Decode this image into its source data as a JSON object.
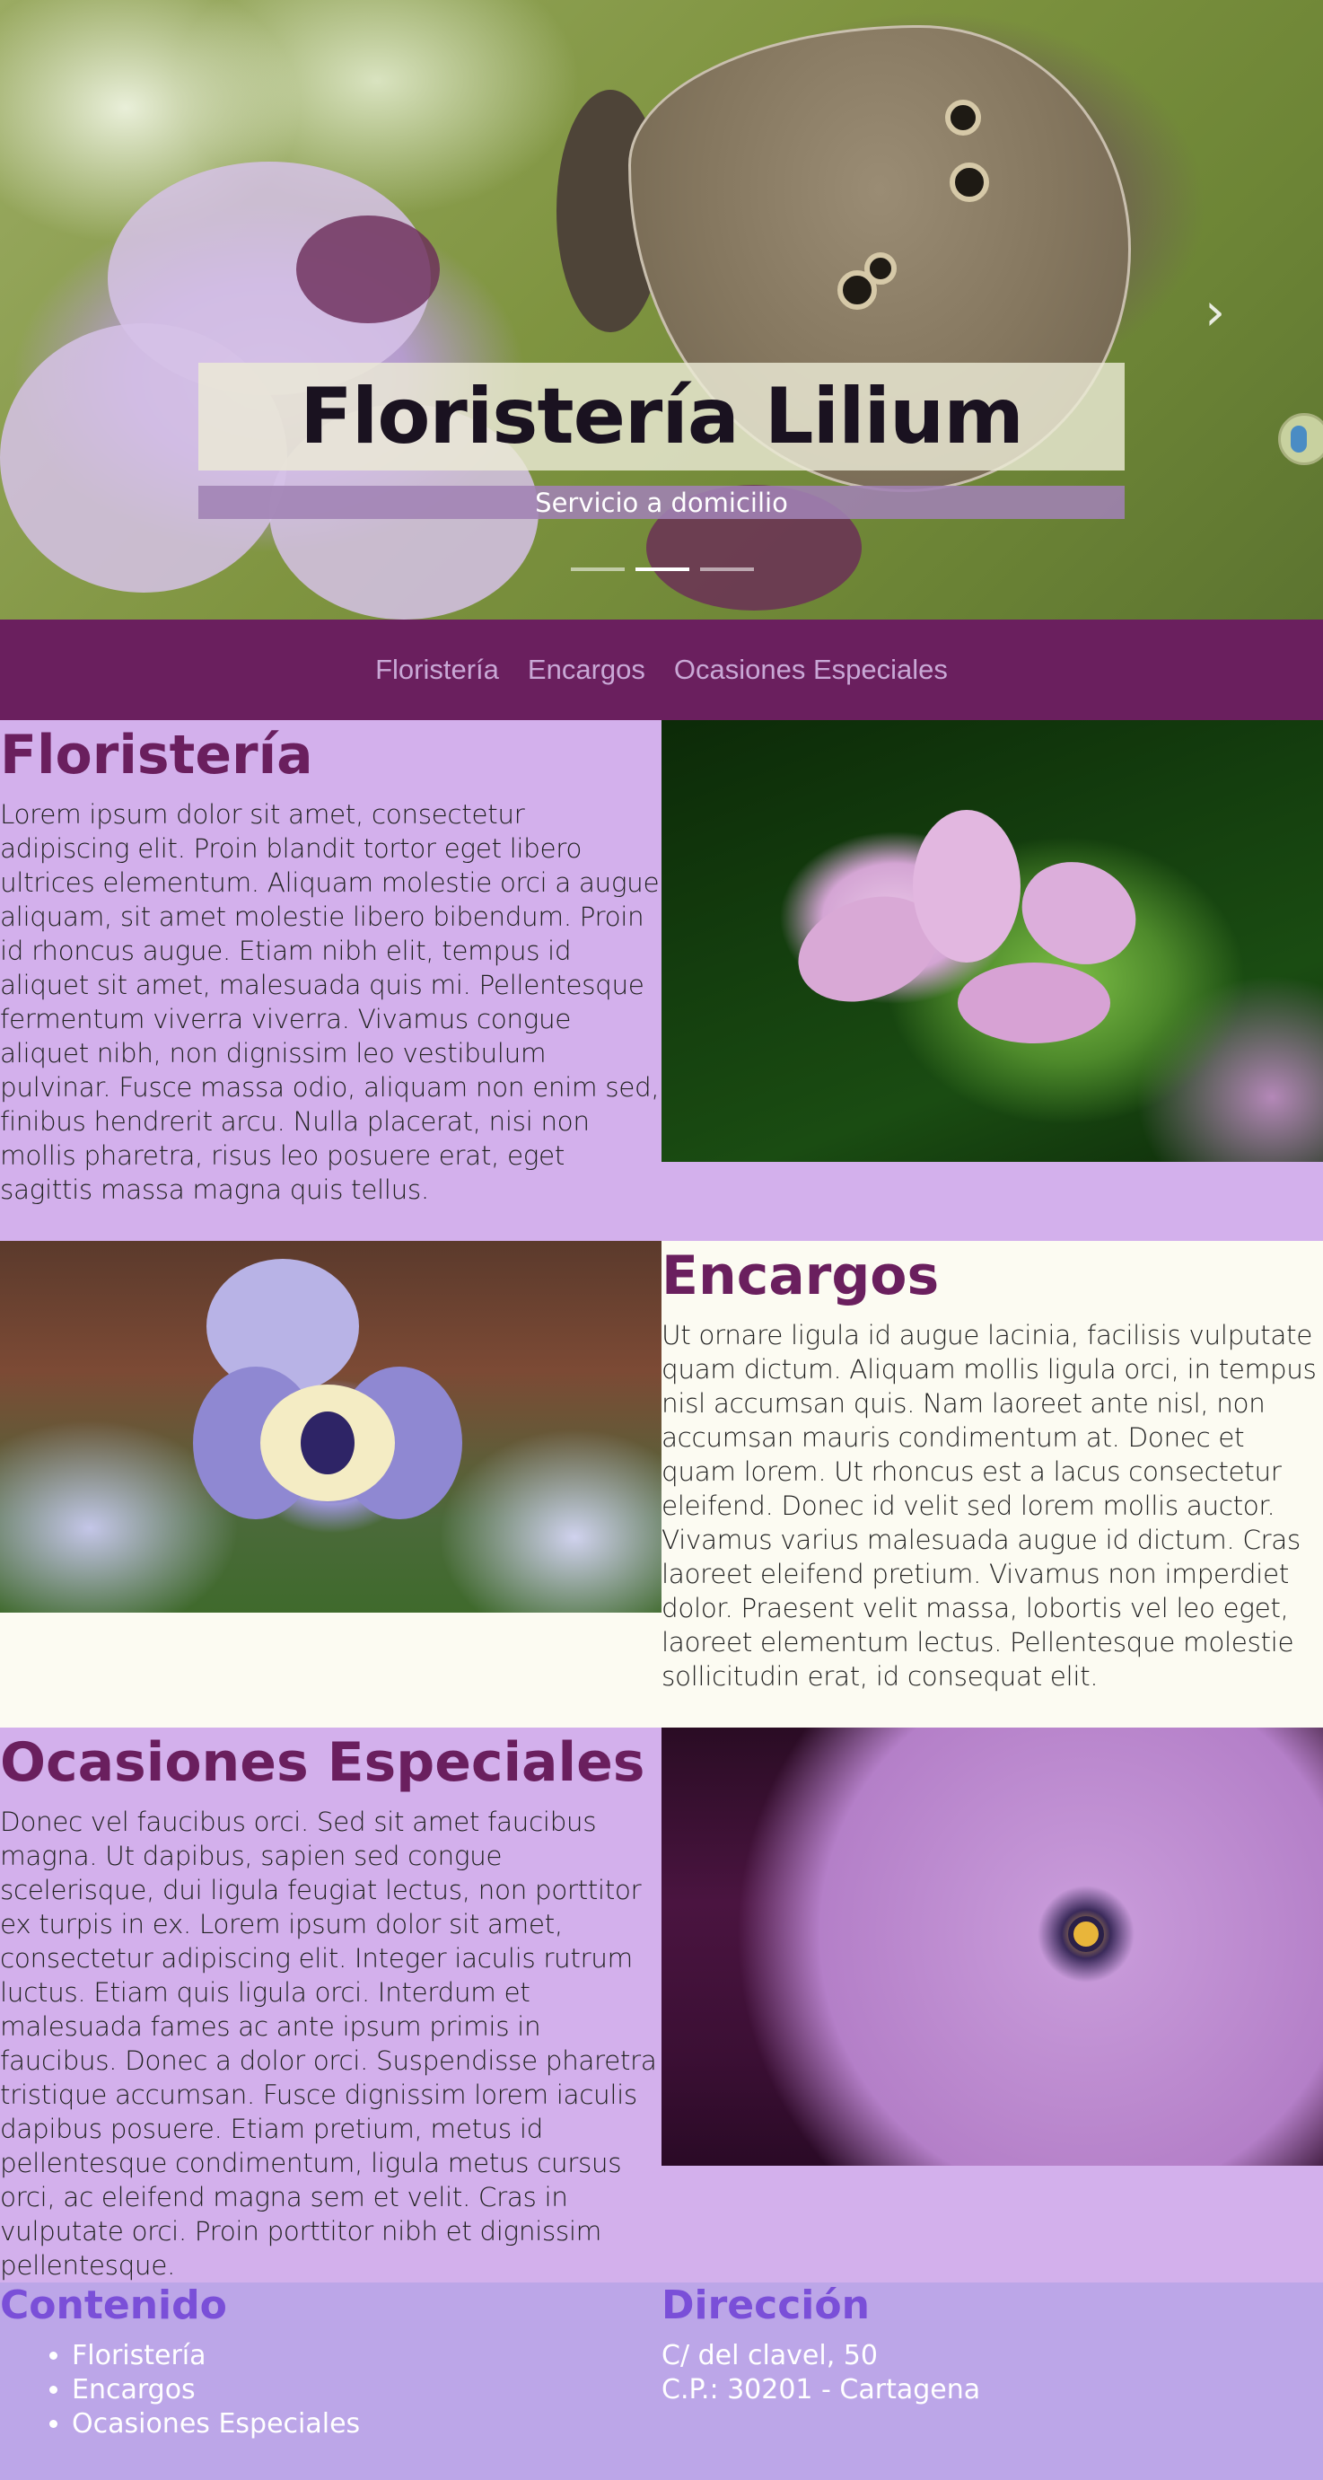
{
  "hero": {
    "title": "Floristería Lilium",
    "subtitle": "Servicio a domicilio",
    "slides": 3,
    "active_slide": 2,
    "next_icon": "chevron-right-icon"
  },
  "nav": {
    "links": [
      "Floristería",
      "Encargos",
      "Ocasiones Especiales"
    ]
  },
  "sections": [
    {
      "title": "Floristería",
      "text": "Lorem ipsum dolor sit amet, consectetur adipiscing elit. Proin blandit tortor eget libero ultrices elementum. Aliquam molestie orci a augue aliquam, sit amet molestie libero bibendum. Proin id rhoncus augue. Etiam nibh elit, tempus id aliquet sit amet, malesuada quis mi. Pellentesque fermentum viverra viverra. Vivamus congue aliquet nibh, non dignissim leo vestibulum pulvinar. Fusce massa odio, aliquam non enim sed, finibus hendrerit arcu. Nulla placerat, nisi non mollis pharetra, risus leo posuere erat, eget sagittis massa magna quis tellus."
    },
    {
      "title": "Encargos",
      "text": "Ut ornare ligula id augue lacinia, facilisis vulputate quam dictum. Aliquam mollis ligula orci, in tempus nisl accumsan quis. Nam laoreet ante nisl, non accumsan mauris condimentum at. Donec et quam lorem. Ut rhoncus est a lacus consectetur eleifend. Donec id velit sed lorem mollis auctor. Vivamus varius malesuada augue id dictum. Cras laoreet eleifend pretium. Vivamus non imperdiet dolor. Praesent velit massa, lobortis vel leo eget, laoreet elementum lectus. Pellentesque molestie sollicitudin erat, id consequat elit."
    },
    {
      "title": "Ocasiones Especiales",
      "text": "Donec vel faucibus orci. Sed sit amet faucibus magna. Ut dapibus, sapien sed congue scelerisque, dui ligula feugiat lectus, non porttitor ex turpis in ex. Lorem ipsum dolor sit amet, consectetur adipiscing elit. Integer iaculis rutrum luctus. Etiam quis ligula orci. Interdum et malesuada fames ac ante ipsum primis in faucibus. Donec a dolor orci. Suspendisse pharetra tristique accumsan. Fusce dignissim lorem iaculis dapibus posuere. Etiam pretium, metus id pellentesque condimentum, ligula metus cursus orci, ac eleifend magna sem et velit. Cras in vulputate orci. Proin porttitor nibh et dignissim pellentesque."
    }
  ],
  "footer": {
    "contenido_title": "Contenido",
    "contenido_items": [
      "Floristería",
      "Encargos",
      "Ocasiones Especiales"
    ],
    "direccion_title": "Dirección",
    "address_line1": "C/ del clavel, 50",
    "address_line2": "C.P.: 30201 - Cartagena"
  },
  "colors": {
    "nav_bg": "#6a1f5e",
    "section_lilac": "#d3b0ec",
    "section_cream": "#fcfbf2",
    "heading": "#6a1f5e",
    "footer_bg": "#bca6e8",
    "footer_heading": "#7a4fd8"
  }
}
